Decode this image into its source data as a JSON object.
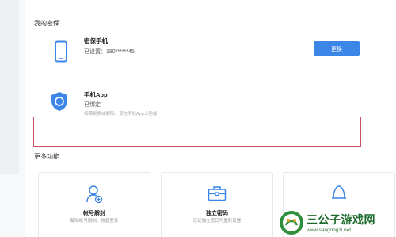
{
  "security": {
    "section_title": "我的密保",
    "phone": {
      "title": "密保手机",
      "status": "已设置：180******45",
      "button_label": "更换"
    },
    "app": {
      "title": "手机App",
      "status": "已绑定",
      "note": "如需更换或解除，请在手机App上完成"
    }
  },
  "more": {
    "section_title": "更多功能",
    "cards": [
      {
        "title": "帐号解封",
        "desc": "解除帐号限制，恢复登录",
        "icon": "user-add-icon"
      },
      {
        "title": "独立密码",
        "desc": "忘记独立密码可重新设置",
        "icon": "briefcase-icon"
      },
      {
        "title": "",
        "desc": "",
        "icon": "person-outline-icon"
      }
    ]
  },
  "watermark": {
    "title": "三公子游戏网",
    "url": "www.sangongzi.net"
  },
  "colors": {
    "accent": "#3b86e6",
    "highlight_border": "#c9535c",
    "watermark_green": "#1c6b2c"
  }
}
